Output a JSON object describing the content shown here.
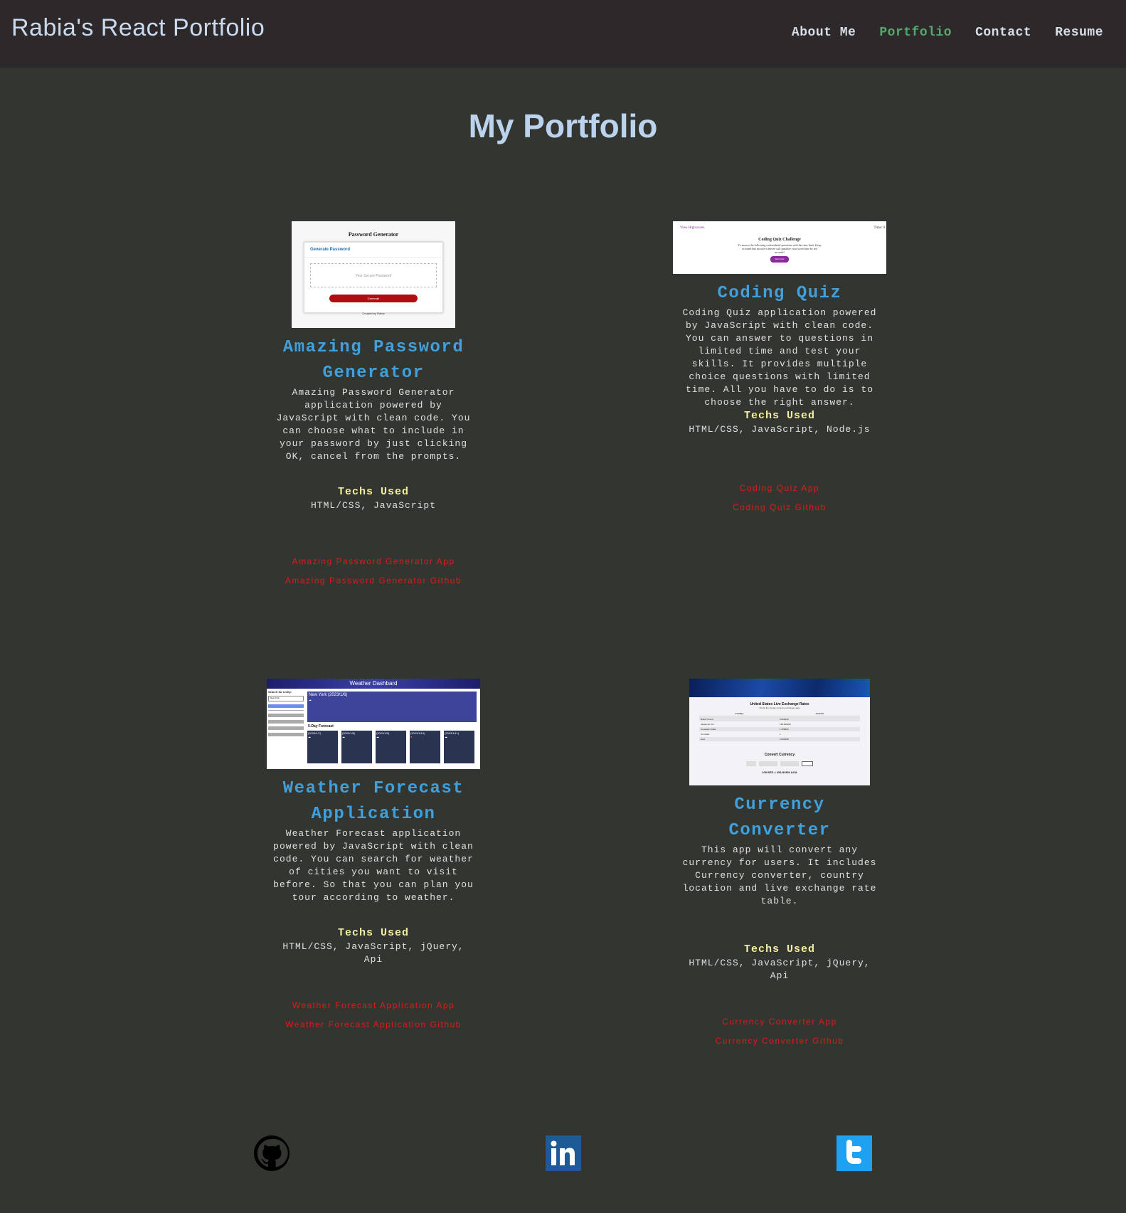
{
  "header": {
    "brand": "Rabia's React Portfolio",
    "nav": [
      "About Me",
      "Portfolio",
      "Contact",
      "Resume"
    ],
    "active_nav": "Portfolio"
  },
  "page_title": "My Portfolio",
  "projects": [
    {
      "title": "Amazing Password Generator",
      "description": "Amazing Password Generator application powered by JavaScript with clean code. You can choose what to include in your password by just clicking OK, cancel from the prompts.",
      "techs_label": "Techs Used",
      "techs": "HTML/CSS, JavaScript",
      "app_link": "Amazing Password Generator App",
      "github_link": "Amazing Password Generator Github",
      "thumb": {
        "heading": "Password Generator",
        "subheading": "Generate Password",
        "placeholder": "Your Secure Password",
        "button": "Generate",
        "footer": "Created by Rabia"
      }
    },
    {
      "title": "Coding Quiz",
      "description": "Coding Quiz application powered by JavaScript with clean code. You can answer to questions in limited time and test your skills. It provides multiple choice questions with limited time. All you have to do is to choose the right answer.",
      "techs_label": "Techs Used",
      "techs": "HTML/CSS, JavaScript, Node.js",
      "app_link": "Coding Quiz App",
      "github_link": "Coding Quiz Github",
      "thumb": {
        "highscores": "View Highscores",
        "time": "Time: 0",
        "heading": "Coding Quiz Challenge",
        "body": "To answer the following codesrelated questions with the time limit. Keep in mind that incorrect answer will penalize your score/time by ten seconds!",
        "button": "Start Quiz"
      }
    },
    {
      "title": "Weather Forecast Application",
      "description": "Weather Forecast application powered by JavaScript with clean code. You can search for weather of cities you want to visit before. So that you can plan you tour according to weather.",
      "techs_label": "Techs Used",
      "techs": "HTML/CSS, JavaScript, jQuery, Api",
      "app_link": "Weather Forecast Application App",
      "github_link": "Weather Forecast Application Github",
      "thumb": {
        "header": "Weather Dashbard",
        "search_label": "Search for a City:",
        "city_value": "New York",
        "current": "New York (2023/1/6)",
        "forecast_label": "5-Day Forecast",
        "days": [
          "(2023/1/7)",
          "(2023/1/8)",
          "(2023/1/9)",
          "(2023/1/10)",
          "(2023/1/11)"
        ]
      }
    },
    {
      "title": "Currency Converter",
      "description": "This app will convert any currency for users. It includes Currency converter, country location and live exchange rate table.",
      "techs_label": "Techs Used",
      "techs": "HTML/CSS, JavaScript, jQuery, Api",
      "app_link": "Currency Converter App",
      "github_link": "Currency Converter Github",
      "thumb": {
        "heading": "United States Live Exchange Rates",
        "sub": "Check the foreign currency exchange rates",
        "col1": "Country",
        "col2": "Amount",
        "rows": [
          [
            "British Pound",
            "0.826228"
          ],
          [
            "Japanese Yen",
            "136.815222"
          ],
          [
            "Canadian Dollar",
            "1.359823"
          ],
          [
            "Us Dollar",
            "1"
          ],
          [
            "Euro",
            "0.960298"
          ]
        ],
        "convert_heading": "Convert Currency",
        "result": "100 BZD = 25128.954 AOA"
      }
    }
  ],
  "footer": {
    "icons": [
      "github-icon",
      "linkedin-icon",
      "twitter-icon"
    ]
  }
}
